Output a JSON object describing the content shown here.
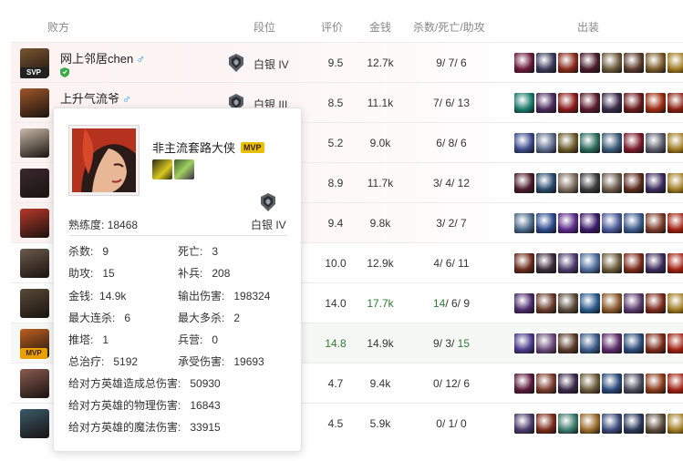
{
  "header": {
    "team": "败方",
    "rank": "段位",
    "rating": "评价",
    "gold": "金钱",
    "kda": "杀数/死亡/助攻",
    "build": "出装"
  },
  "players": [
    {
      "name": "网上邻居chen",
      "gender": "♂",
      "badge": "SVP",
      "rank": "白银 IV",
      "rating": "9.5",
      "gold": "12.7k",
      "k": "9",
      "d": "7",
      "a": "6",
      "highlight": "",
      "row_style": "lose",
      "avatar_color": "#7a5530"
    },
    {
      "name": "上升气流爷",
      "gender": "♂",
      "badge": "",
      "rank": "白银 III",
      "rating": "8.5",
      "gold": "11.1k",
      "k": "7",
      "d": "6",
      "a": "13",
      "highlight": "",
      "row_style": "lose",
      "avatar_color": "#a0562a"
    },
    {
      "name": "",
      "gender": "",
      "badge": "",
      "rank": "",
      "rating": "5.2",
      "gold": "9.0k",
      "k": "6",
      "d": "8",
      "a": "6",
      "highlight": "",
      "row_style": "lose",
      "avatar_color": "#c9b9a8"
    },
    {
      "name": "",
      "gender": "",
      "badge": "",
      "rank": "",
      "rating": "8.9",
      "gold": "11.7k",
      "k": "3",
      "d": "4",
      "a": "12",
      "highlight": "",
      "row_style": "lose",
      "avatar_color": "#3a2830"
    },
    {
      "name": "",
      "gender": "",
      "badge": "",
      "rank": "",
      "rating": "9.4",
      "gold": "9.8k",
      "k": "3",
      "d": "2",
      "a": "7",
      "highlight": "",
      "row_style": "lose",
      "avatar_color": "#b8372a"
    },
    {
      "name": "",
      "gender": "",
      "badge": "",
      "rank": "",
      "rating": "10.0",
      "gold": "12.9k",
      "k": "4",
      "d": "6",
      "a": "11",
      "highlight": "",
      "row_style": "",
      "avatar_color": "#6b5a4a"
    },
    {
      "name": "",
      "gender": "",
      "badge": "",
      "rank": "",
      "rating": "14.0",
      "gold": "17.7k",
      "k": "14",
      "d": "6",
      "a": "9",
      "highlight": "gold_kill",
      "row_style": "",
      "avatar_color": "#5a4a38"
    },
    {
      "name": "",
      "gender": "",
      "badge": "MVP",
      "rank": "",
      "rating": "14.8",
      "gold": "14.9k",
      "k": "9",
      "d": "3",
      "a": "15",
      "highlight": "rating_assist",
      "row_style": "mvp-row",
      "avatar_color": "#c06020"
    },
    {
      "name": "",
      "gender": "",
      "badge": "",
      "rank": "",
      "rating": "4.7",
      "gold": "9.4k",
      "k": "0",
      "d": "12",
      "a": "6",
      "highlight": "",
      "row_style": "",
      "avatar_color": "#8a5a50"
    },
    {
      "name": "",
      "gender": "",
      "badge": "",
      "rank": "",
      "rating": "4.5",
      "gold": "5.9k",
      "k": "0",
      "d": "1",
      "a": "0",
      "highlight": "",
      "row_style": "",
      "avatar_color": "#3a5a6a"
    }
  ],
  "item_colors": [
    [
      "#6a1a3a",
      "#3a3a5a",
      "#8a2a1a",
      "#4a1a2a",
      "#6a5a3a",
      "#5a3a2a",
      "#7a5a2a",
      "#a07a20"
    ],
    [
      "#1a7a6a",
      "#4a2a5a",
      "#8a1a1a",
      "#5a1a2a",
      "#3a2a4a",
      "#6a1a1a",
      "#9a2a10",
      "#8a2010"
    ],
    [
      "#3a4a8a",
      "#5a6a8a",
      "#6a5a2a",
      "#2a6a5a",
      "#3a5a7a",
      "#7a1a2a",
      "#5a5a6a",
      "#a07a20"
    ],
    [
      "#4a1a2a",
      "#2a4a6a",
      "#7a6a5a",
      "#3a3a3a",
      "#6a5a4a",
      "#5a2a1a",
      "#3a2a5a",
      "#a07a20"
    ],
    [
      "#4a6a8a",
      "#2a4a8a",
      "#5a2a8a",
      "#3a1a6a",
      "#4a5a9a",
      "#3a5a8a",
      "#7a3a2a",
      "#a02010"
    ],
    [
      "#6a2a1a",
      "#3a2a3a",
      "#4a3a6a",
      "#4a6a9a",
      "#6a5a3a",
      "#7a2a1a",
      "#3a2a5a",
      "#a02010"
    ],
    [
      "#4a2a6a",
      "#6a3a2a",
      "#5a4a3a",
      "#2a5a8a",
      "#8a5a2a",
      "#5a3a6a",
      "#7a2a1a",
      "#a07a20"
    ],
    [
      "#4a3a8a",
      "#6a4a7a",
      "#5a3a2a",
      "#3a5a8a",
      "#5a2a6a",
      "#2a4a7a",
      "#7a2a1a",
      "#a02010"
    ],
    [
      "#5a1a3a",
      "#7a3a2a",
      "#3a2a4a",
      "#6a5a3a",
      "#2a4a7a",
      "#4a4a5a",
      "#8a3a1a",
      "#a02010"
    ],
    [
      "#4a3a6a",
      "#7a2a1a",
      "#3a7a6a",
      "#9a6a2a",
      "#3a4a7a",
      "#2a3a5a",
      "#5a4a3a",
      "#a07a20"
    ]
  ],
  "tooltip": {
    "title": "非主流套路大侠",
    "mvp": "MVP",
    "rank": "白银 IV",
    "proficiency_label": "熟练度:",
    "proficiency_value": "18468",
    "stats": {
      "kills_label": "杀数:",
      "kills": "9",
      "deaths_label": "死亡:",
      "deaths": "3",
      "assists_label": "助攻:",
      "assists": "15",
      "cs_label": "补兵:",
      "cs": "208",
      "gold_label": "金钱:",
      "gold": "14.9k",
      "damage_out_label": "输出伤害:",
      "damage_out": "198324",
      "max_streak_label": "最大连杀:",
      "max_streak": "6",
      "max_multi_label": "最大多杀:",
      "max_multi": "2",
      "towers_label": "推塔:",
      "towers": "1",
      "barracks_label": "兵营:",
      "barracks": "0",
      "heal_label": "总治疗:",
      "heal": "5192",
      "taken_label": "承受伤害:",
      "taken": "19693",
      "champ_dmg_label": "给对方英雄造成总伤害:",
      "champ_dmg": "50930",
      "phys_dmg_label": "给对方英雄的物理伤害:",
      "phys_dmg": "16843",
      "magic_dmg_label": "给对方英雄的魔法伤害:",
      "magic_dmg": "33915"
    }
  }
}
